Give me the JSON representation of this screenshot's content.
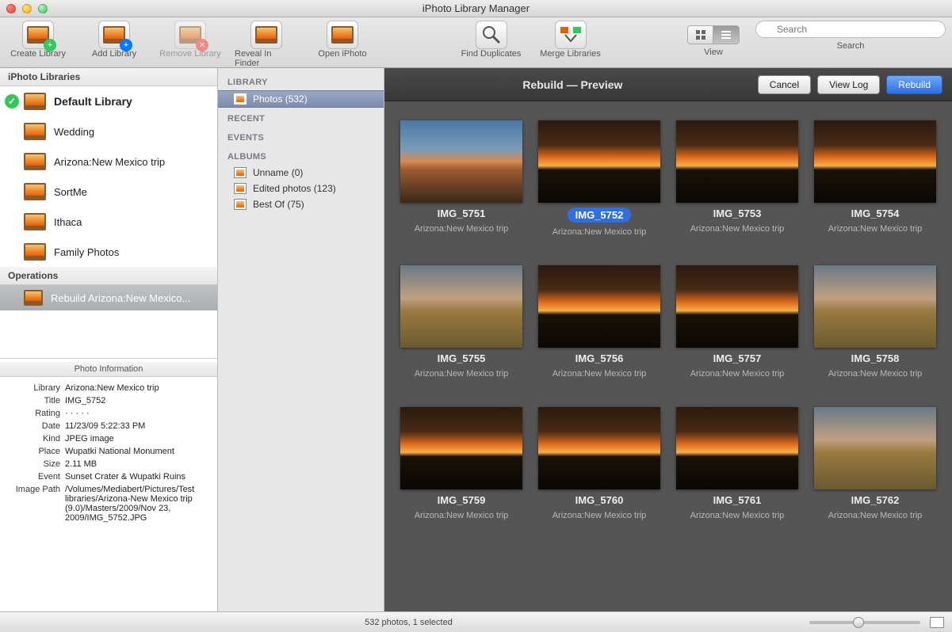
{
  "window": {
    "title": "iPhoto Library Manager"
  },
  "toolbar": {
    "create": "Create Library",
    "add": "Add Library",
    "remove": "Remove Library",
    "reveal": "Reveal In Finder",
    "open": "Open iPhoto",
    "find_dup": "Find Duplicates",
    "merge": "Merge Libraries",
    "view": "View",
    "search_label": "Search",
    "search_placeholder": "Search"
  },
  "sidebar": {
    "libs_header": "iPhoto Libraries",
    "libraries": [
      {
        "name": "Default Library",
        "default": true
      },
      {
        "name": "Wedding"
      },
      {
        "name": "Arizona:New Mexico trip"
      },
      {
        "name": "SortMe"
      },
      {
        "name": "Ithaca"
      },
      {
        "name": "Family Photos"
      }
    ],
    "ops_header": "Operations",
    "operations": [
      {
        "name": "Rebuild Arizona:New Mexico..."
      }
    ]
  },
  "navigator": {
    "library_h": "LIBRARY",
    "photos_label": "Photos (532)",
    "recent_h": "RECENT",
    "events_h": "EVENTS",
    "albums_h": "ALBUMS",
    "albums": [
      {
        "name": "Unname (0)"
      },
      {
        "name": "Edited photos (123)"
      },
      {
        "name": "Best Of (75)"
      }
    ]
  },
  "content": {
    "header_title": "Rebuild — Preview",
    "btn_cancel": "Cancel",
    "btn_viewlog": "View Log",
    "btn_rebuild": "Rebuild",
    "sub": "Arizona:New Mexico trip",
    "photos": [
      {
        "name": "IMG_5751",
        "cls": "sky2"
      },
      {
        "name": "IMG_5752",
        "cls": "sky",
        "selected": true
      },
      {
        "name": "IMG_5753",
        "cls": "sky"
      },
      {
        "name": "IMG_5754",
        "cls": "sky"
      },
      {
        "name": "IMG_5755",
        "cls": "sky3"
      },
      {
        "name": "IMG_5756",
        "cls": "sky"
      },
      {
        "name": "IMG_5757",
        "cls": "sky"
      },
      {
        "name": "IMG_5758",
        "cls": "sky3"
      },
      {
        "name": "IMG_5759",
        "cls": "sky"
      },
      {
        "name": "IMG_5760",
        "cls": "sky"
      },
      {
        "name": "IMG_5761",
        "cls": "sky"
      },
      {
        "name": "IMG_5762",
        "cls": "sky3"
      }
    ]
  },
  "info": {
    "title": "Photo Information",
    "rows": [
      {
        "k": "Library",
        "v": "Arizona:New Mexico trip"
      },
      {
        "k": "Title",
        "v": "IMG_5752"
      },
      {
        "k": "Rating",
        "v": "· · · · ·"
      },
      {
        "k": "Date",
        "v": "11/23/09 5:22:33 PM"
      },
      {
        "k": "Kind",
        "v": "JPEG image"
      },
      {
        "k": "Place",
        "v": "Wupatki National Monument"
      },
      {
        "k": "Size",
        "v": "2.11 MB"
      },
      {
        "k": "Event",
        "v": "Sunset Crater & Wupatki Ruins"
      },
      {
        "k": "Image Path",
        "v": "/Volumes/Mediabert/Pictures/Test libraries/Arizona-New Mexico trip (9.0)/Masters/2009/Nov 23, 2009/IMG_5752.JPG"
      }
    ]
  },
  "status": {
    "text": "532 photos, 1 selected"
  }
}
